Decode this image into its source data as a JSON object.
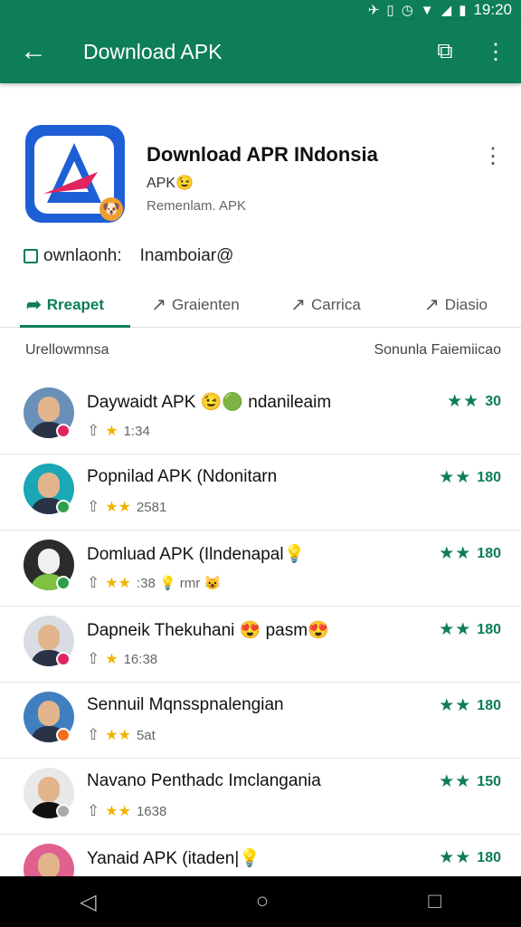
{
  "status_bar": {
    "time": "19:20",
    "icons": [
      "vibrate-icon",
      "phone-icon",
      "alarm-icon",
      "wifi-icon",
      "signal-icon",
      "battery-icon"
    ]
  },
  "toolbar": {
    "title": "Download APK",
    "back_icon": "arrow-left-icon",
    "cast_icon": "cast-icon",
    "more_icon": "more-vertical-icon"
  },
  "app": {
    "title": "Download APR INdonsia",
    "subtitle": "APK😉",
    "meta": "Remenlam. APK"
  },
  "download_row": {
    "label": "ownlaonh:",
    "value": "Inamboiar@"
  },
  "tabs": [
    {
      "label": "Rreapet",
      "icon": "share-icon",
      "active": true
    },
    {
      "label": "Graienten",
      "icon": "share-icon",
      "active": false
    },
    {
      "label": "Carrica",
      "icon": "share-icon",
      "active": false
    },
    {
      "label": "Diasio",
      "icon": "share-icon",
      "active": false
    }
  ],
  "section": {
    "left": "Urellowmnsa",
    "right": "Sonunla Faiemiicao"
  },
  "items": [
    {
      "title": "Daywaidt APK 😉🟢 ndanileaim",
      "sub": "1:34",
      "stars_small": "★",
      "rating": "30",
      "badge_color": "#e0245e"
    },
    {
      "title": "Popnilad APK (Ndonitarn",
      "sub": "2581",
      "stars_small": "★★",
      "rating": "180",
      "badge_color": "#2e9e4a"
    },
    {
      "title": "Domluad APK (Ilndenapal💡",
      "sub": ":38 💡 rmr 😺",
      "stars_small": "★★",
      "rating": "180",
      "badge_color": "#2e9e4a"
    },
    {
      "title": "Dapneik Thekuhani 😍 pasm😍",
      "sub": "16:38",
      "stars_small": "★",
      "rating": "180",
      "badge_color": "#e0245e"
    },
    {
      "title": "Sennuil Mqnsspnalengian",
      "sub": "5at",
      "stars_small": "★★",
      "rating": "180",
      "badge_color": "#f07020"
    },
    {
      "title": "Navano Penthadc Imclangania",
      "sub": "1638",
      "stars_small": "★★",
      "rating": "150",
      "badge_color": "#aaaaaa"
    },
    {
      "title": "Yanaid APK (itaden|💡",
      "sub": "",
      "stars_small": "",
      "rating": "180",
      "badge_color": "#e0245e"
    }
  ],
  "nav": {
    "back": "◁",
    "home": "○",
    "recent": "□"
  },
  "colors": {
    "primary": "#0e7d5a",
    "star": "#f0b400"
  }
}
